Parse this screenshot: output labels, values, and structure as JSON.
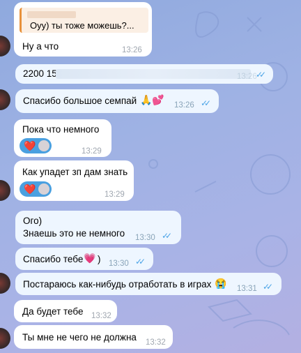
{
  "messages": [
    {
      "id": "m0",
      "side": "in",
      "reply_quote": "Оуу) ты тоже можешь?...",
      "text": "Ну а что",
      "time": "13:26"
    },
    {
      "id": "m1",
      "side": "out",
      "text": "2200 15",
      "time": "13:26"
    },
    {
      "id": "m2",
      "side": "out",
      "text": "Спасибо большое семпай",
      "emoji": "🙏💕",
      "time": "13:26"
    },
    {
      "id": "m3",
      "side": "in",
      "text": "Пока что немного",
      "time": "13:29",
      "reaction": "❤️"
    },
    {
      "id": "m4",
      "side": "in",
      "text": "Как упадет зп дам знать",
      "time": "13:29",
      "reaction": "❤️"
    },
    {
      "id": "m5",
      "side": "out",
      "text": "Ого)",
      "text2": "Знаешь это не немного",
      "time": "13:30"
    },
    {
      "id": "m6",
      "side": "out",
      "text": "Спасибо тебе",
      "emoji": "💗",
      "text_after": ")",
      "time": "13:30"
    },
    {
      "id": "m7",
      "side": "out",
      "text": "Постараюсь как-нибудь отработать в играх",
      "emoji": "😭",
      "time": "13:31"
    },
    {
      "id": "m8",
      "side": "in",
      "text": "Да будет тебе",
      "time": "13:32"
    },
    {
      "id": "m9",
      "side": "in",
      "text": "Ты мне не чего не должна",
      "time": "13:32"
    }
  ],
  "colors": {
    "accent": "#4aa3e6",
    "reaction_bg": "#4aa0e0",
    "heart": "#e8192c"
  }
}
